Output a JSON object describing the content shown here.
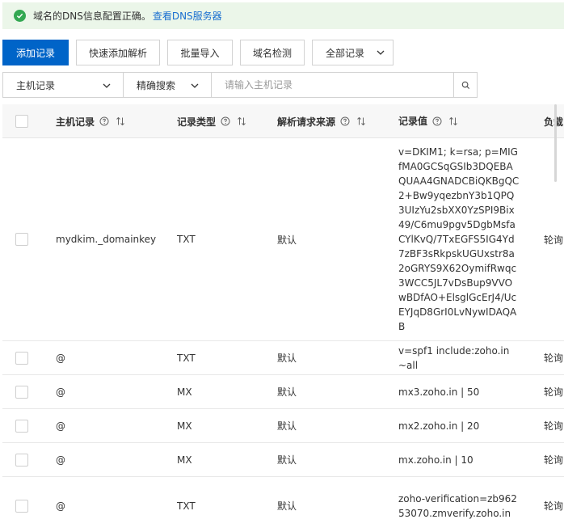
{
  "banner": {
    "message": "域名的DNS信息配置正确。",
    "link": "查看DNS服务器"
  },
  "toolbar": {
    "add_record": "添加记录",
    "quick_add": "快速添加解析",
    "batch_import": "批量导入",
    "domain_check": "域名检测",
    "all_records": "全部记录"
  },
  "search": {
    "field_select": "主机记录",
    "mode_select": "精确搜索",
    "placeholder": "请输入主机记录"
  },
  "table": {
    "headers": {
      "host": "主机记录",
      "type": "记录类型",
      "source": "解析请求来源",
      "value": "记录值",
      "extra": "负载"
    },
    "rows": [
      {
        "host": "mydkim._domainkey",
        "type": "TXT",
        "source": "默认",
        "value": "v=DKIM1; k=rsa; p=MIGfMA0GCSqGSIb3DQEBAQUAA4GNADCBiQKBgQC2+Bw9yqezbnY3b1QPQ3UIzYu2sbXX0YzSPI9Bix49/C6mu9pgv5DgbMsfaCYlKvQ/7TxEGFS5IG4Yd7zBF3sRkpskUGUxstr8a2oGRYS9X62OymifRwqc3WCC5JL7vDsBup9VVOwBDfAO+ElsglGcErJ4/UcEYJqD8GrI0LvNywIDAQAB",
        "extra": "轮询"
      },
      {
        "host": "@",
        "type": "TXT",
        "source": "默认",
        "value": "v=spf1 include:zoho.in ~all",
        "extra": "轮询"
      },
      {
        "host": "@",
        "type": "MX",
        "source": "默认",
        "value": "mx3.zoho.in | 50",
        "extra": "轮询"
      },
      {
        "host": "@",
        "type": "MX",
        "source": "默认",
        "value": "mx2.zoho.in | 20",
        "extra": "轮询"
      },
      {
        "host": "@",
        "type": "MX",
        "source": "默认",
        "value": "mx.zoho.in | 10",
        "extra": "轮询"
      },
      {
        "host": "@",
        "type": "TXT",
        "source": "默认",
        "value": "zoho-verification=zb96253070.zmverify.zoho.in",
        "extra": "轮询"
      }
    ]
  },
  "colors": {
    "primary": "#0064c8",
    "success": "#33a852",
    "banner_bg": "#ebf6e9",
    "link": "#1a6fd0"
  },
  "icons": [
    "check-circle-icon",
    "chevron-down-icon",
    "search-icon",
    "help-circle-icon",
    "sort-icon"
  ]
}
